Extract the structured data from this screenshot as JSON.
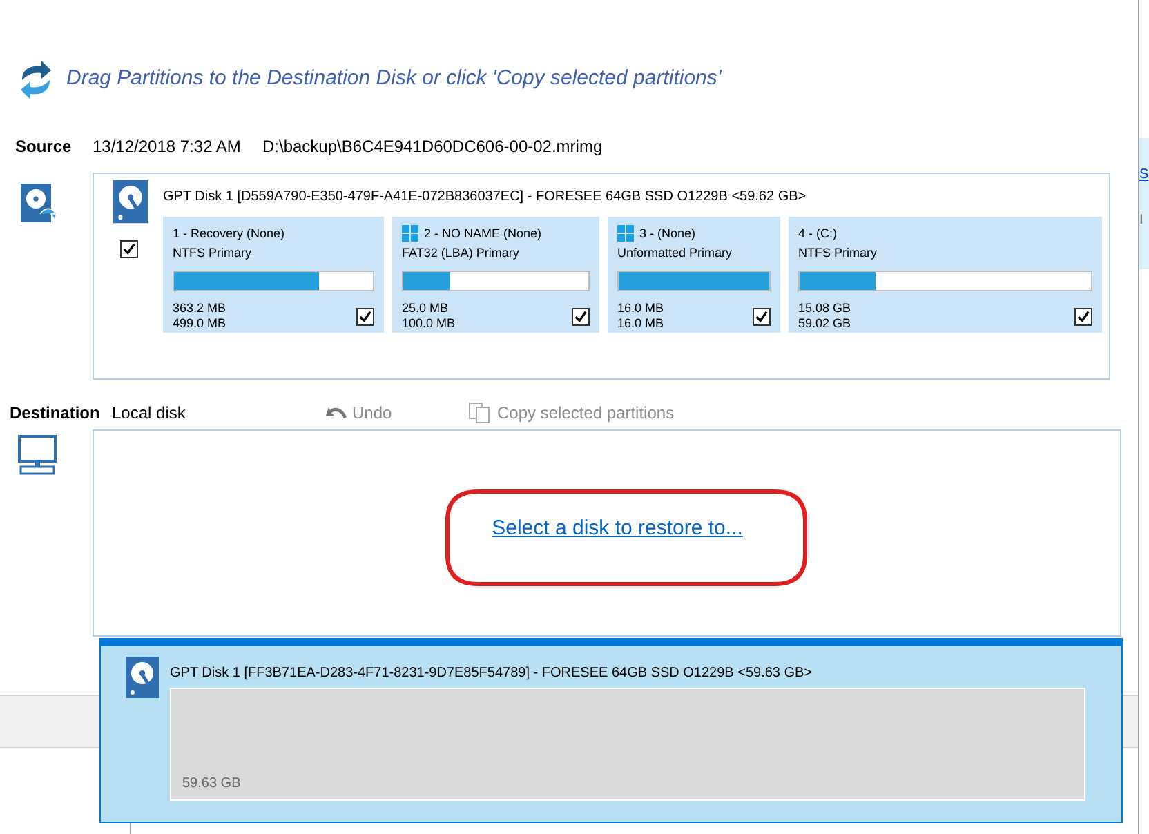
{
  "header": {
    "text": "Drag Partitions to the Destination Disk or click 'Copy selected partitions'"
  },
  "source": {
    "label": "Source",
    "date": "13/12/2018 7:32 AM",
    "path": "D:\\backup\\B6C4E941D60DC606-00-02.mrimg",
    "disk": {
      "title": "GPT Disk 1 [D559A790-E350-479F-A41E-072B836037EC] - FORESEE 64GB SSD O1229B  <59.62 GB>",
      "checked": true,
      "partitions": [
        {
          "name": "1 - Recovery (None)",
          "type": "NTFS Primary",
          "used": "363.2 MB",
          "total": "499.0 MB",
          "level": 0.73,
          "checked": true,
          "windows_logo": false
        },
        {
          "name": "2 - NO NAME (None)",
          "type": "FAT32 (LBA) Primary",
          "used": "25.0 MB",
          "total": "100.0 MB",
          "level": 0.25,
          "checked": true,
          "windows_logo": true
        },
        {
          "name": "3 -  (None)",
          "type": "Unformatted Primary",
          "used": "16.0 MB",
          "total": "16.0 MB",
          "level": 1,
          "checked": true,
          "windows_logo": true
        },
        {
          "name": "4 -  (C:)",
          "type": "NTFS Primary",
          "used": "15.08 GB",
          "total": "59.02 GB",
          "level": 0.26,
          "checked": true,
          "windows_logo": false
        }
      ]
    }
  },
  "destination": {
    "label": "Destination",
    "disk_type": "Local disk",
    "undo": {
      "label": "Undo",
      "disabled": true
    },
    "copy": {
      "label": "Copy selected partitions",
      "disabled": true
    },
    "link": "Select a disk to restore to..."
  },
  "dropdown": {
    "title": "GPT Disk 1 [FF3B71EA-D283-4F71-8231-9D7E85F54789] - FORESEE 64GB SSD O1229B  <59.63 GB>",
    "size": "59.63 GB"
  },
  "background_window": {
    "link": "S",
    "text": "I"
  }
}
